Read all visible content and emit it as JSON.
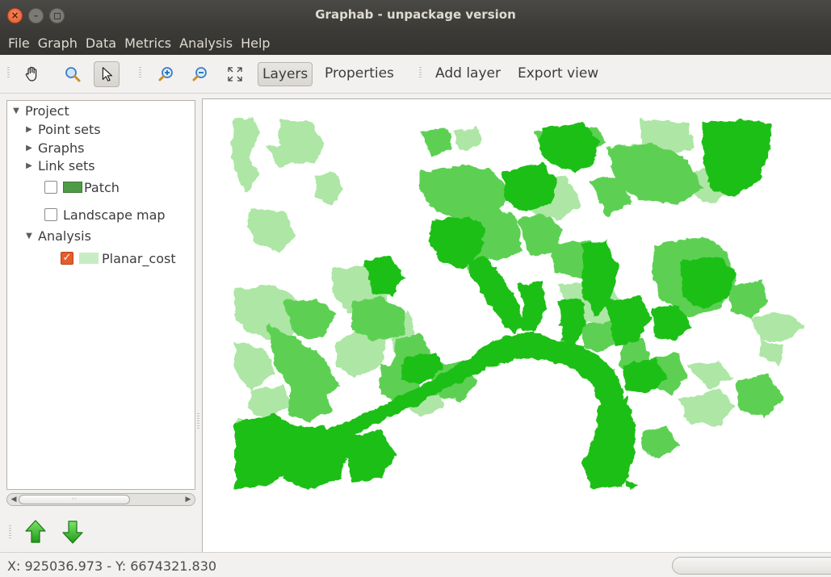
{
  "window": {
    "title": "Graphab - unpackage version"
  },
  "menu": [
    "File",
    "Graph",
    "Data",
    "Metrics",
    "Analysis",
    "Help"
  ],
  "toolbar": {
    "icons": [
      "hand-pan-icon",
      "magnifier-icon",
      "pointer-arrow-icon",
      "zoom-in-icon",
      "zoom-out-icon",
      "fit-extent-icon"
    ],
    "layers_label": "Layers",
    "properties_label": "Properties",
    "add_layer_label": "Add layer",
    "export_view_label": "Export view"
  },
  "tree": {
    "project": "Project",
    "point_sets": "Point sets",
    "graphs": "Graphs",
    "link_sets": "Link sets",
    "patch": {
      "label": "Patch",
      "checked": false,
      "color": "#4f9a45"
    },
    "landscape": {
      "label": "Landscape map",
      "checked": false
    },
    "analysis": "Analysis",
    "planar_cost": {
      "label": "Planar_cost",
      "checked": true,
      "color": "#c8ecc4"
    }
  },
  "map": {
    "colors": {
      "dark": "#1dbf12",
      "mid": "#5dd052",
      "light": "#a9e5a1"
    }
  },
  "status": {
    "coords": "X: 925036.973 - Y: 6674321.830"
  },
  "theme": {
    "accent": "#e65c2b",
    "titlebar": "#3c3b37"
  }
}
